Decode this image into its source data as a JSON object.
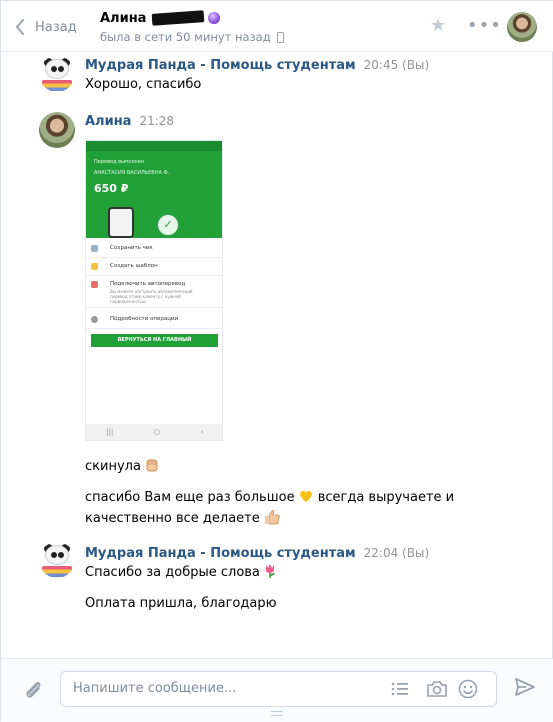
{
  "header": {
    "back_label": "Назад",
    "peer_name": "Алина",
    "peer_status": "была в сети 50 минут назад"
  },
  "messages": [
    {
      "author": "Мудрая Панда - Помощь студентам",
      "time": "20:45 (Вы)",
      "lines": [
        "Хорошо, спасибо"
      ]
    },
    {
      "author": "Алина",
      "time": "21:28",
      "attachment": {
        "status_title": "Перевод выполнен",
        "recipient": "АНАСТАСИЯ ВАСИЛЬЕВНА Ф.",
        "amount": "650 ₽",
        "menu": [
          "Сохранить чек",
          "Создать шаблон",
          "Подключить автоперевод",
          "Подробности операции"
        ],
        "autopay_hint": "Вы можете настроить автоматический перевод этому клиенту с нужной периодичностью",
        "button": "ВЕРНУТЬСЯ НА ГЛАВНЫЙ"
      },
      "lines": [
        "скинула",
        "спасибо Вам еще раз большое",
        "всегда выручаете и",
        "качественно все делаете"
      ]
    },
    {
      "author": "Мудрая Панда - Помощь студентам",
      "time": "22:04 (Вы)",
      "lines": [
        "Спасибо за добрые слова",
        "Оплата пришла, благодарю"
      ]
    }
  ],
  "composer": {
    "placeholder": "Напишите сообщение..."
  },
  "icons": [
    "back-arrow-icon",
    "star-icon",
    "more-icon",
    "phone-icon",
    "paperclip-icon",
    "template-list-icon",
    "camera-icon",
    "smile-icon",
    "send-icon"
  ],
  "colors": {
    "link": "#2a5885",
    "secondary": "#818c99",
    "sber_green": "#21a038"
  }
}
